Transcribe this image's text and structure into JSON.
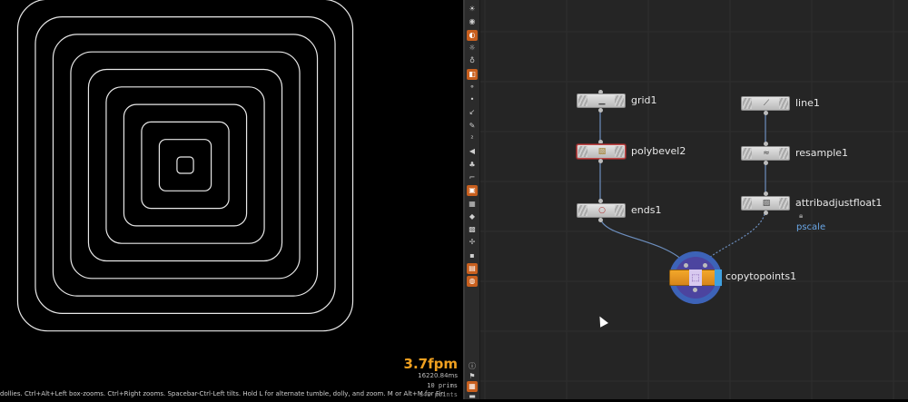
{
  "viewport": {
    "fps": "3.7fpm",
    "frame_time": "16220.84ms",
    "prims": "10  prims",
    "points": "840  points",
    "hint": "dollies. Ctrl+Alt+Left box-zooms. Ctrl+Right zooms. Spacebar-Ctrl-Left tilts. Hold L for alternate tumble, dolly, and zoom. M or Alt+M for First Pers"
  },
  "toolbar": [
    {
      "name": "light-icon",
      "glyph": "☀",
      "on": false
    },
    {
      "name": "camera-icon",
      "glyph": "◉",
      "on": false
    },
    {
      "name": "cam-light-icon",
      "glyph": "◐",
      "on": true
    },
    {
      "name": "point-light-icon",
      "glyph": "☼",
      "on": false
    },
    {
      "name": "spot-icon",
      "glyph": "♁",
      "on": false
    },
    {
      "name": "orient-icon",
      "glyph": "◧",
      "on": true
    },
    {
      "name": "snap-icon",
      "glyph": "⚬",
      "on": false
    },
    {
      "name": "dot-icon",
      "glyph": "•",
      "on": false
    },
    {
      "name": "arrow-icon",
      "glyph": "↙",
      "on": false
    },
    {
      "name": "pen-icon",
      "glyph": "✎",
      "on": false
    },
    {
      "name": "sub-icon",
      "glyph": "²",
      "on": false
    },
    {
      "name": "speaker-icon",
      "glyph": "◀",
      "on": false
    },
    {
      "name": "brush-icon",
      "glyph": "♣",
      "on": false
    },
    {
      "name": "bracket-icon",
      "glyph": "⌐",
      "on": false
    },
    {
      "name": "display-icon",
      "glyph": "▣",
      "on": true
    },
    {
      "name": "shade-icon",
      "glyph": "▦",
      "on": false
    },
    {
      "name": "diamond-icon",
      "glyph": "◆",
      "on": false
    },
    {
      "name": "grid-icon",
      "glyph": "▩",
      "on": false
    },
    {
      "name": "vector-icon",
      "glyph": "✢",
      "on": false
    },
    {
      "name": "box-icon",
      "glyph": "▪",
      "on": false
    },
    {
      "name": "render-icon",
      "glyph": "▤",
      "on": true
    },
    {
      "name": "pin-icon",
      "glyph": "◍",
      "on": true
    },
    {
      "name": "info-icon",
      "glyph": "ⓘ",
      "on": false
    },
    {
      "name": "flag-icon",
      "glyph": "⚑",
      "on": false
    },
    {
      "name": "tiles-icon",
      "glyph": "▦",
      "on": true
    },
    {
      "name": "screen-icon",
      "glyph": "▬",
      "on": false
    }
  ],
  "nodes": {
    "grid": {
      "label": "grid1",
      "icon_name": "grid-node-icon",
      "glyph": "▁"
    },
    "polybevel": {
      "label": "polybevel2",
      "icon_name": "box-node-icon",
      "glyph": "▧"
    },
    "ends": {
      "label": "ends1",
      "icon_name": "circle-node-icon",
      "glyph": "○"
    },
    "line": {
      "label": "line1",
      "icon_name": "line-node-icon",
      "glyph": "⟋"
    },
    "resample": {
      "label": "resample1",
      "icon_name": "wave-node-icon",
      "glyph": "≈"
    },
    "attribadjust": {
      "label": "attribadjustfloat1",
      "icon_name": "adjust-node-icon",
      "glyph": "▨"
    },
    "copytopoints": {
      "label": "copytopoints1",
      "icon_name": "copy-node-icon",
      "glyph": "⬚"
    }
  },
  "pscale_label": "pscale"
}
